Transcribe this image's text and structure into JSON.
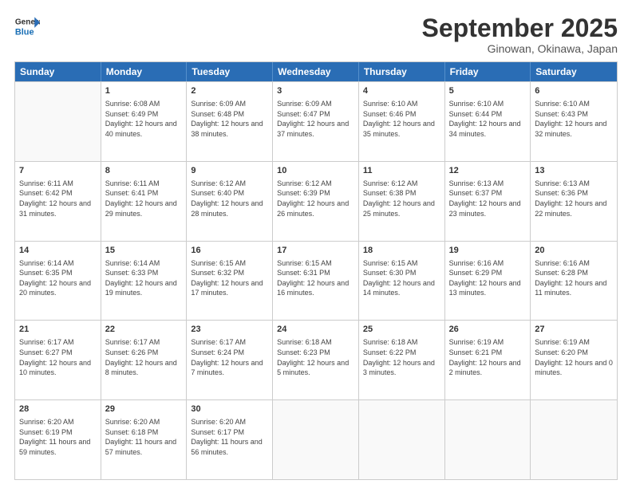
{
  "logo": {
    "line1": "General",
    "line2": "Blue"
  },
  "title": "September 2025",
  "location": "Ginowan, Okinawa, Japan",
  "weekdays": [
    "Sunday",
    "Monday",
    "Tuesday",
    "Wednesday",
    "Thursday",
    "Friday",
    "Saturday"
  ],
  "rows": [
    [
      {
        "day": "",
        "sunrise": "",
        "sunset": "",
        "daylight": ""
      },
      {
        "day": "1",
        "sunrise": "Sunrise: 6:08 AM",
        "sunset": "Sunset: 6:49 PM",
        "daylight": "Daylight: 12 hours and 40 minutes."
      },
      {
        "day": "2",
        "sunrise": "Sunrise: 6:09 AM",
        "sunset": "Sunset: 6:48 PM",
        "daylight": "Daylight: 12 hours and 38 minutes."
      },
      {
        "day": "3",
        "sunrise": "Sunrise: 6:09 AM",
        "sunset": "Sunset: 6:47 PM",
        "daylight": "Daylight: 12 hours and 37 minutes."
      },
      {
        "day": "4",
        "sunrise": "Sunrise: 6:10 AM",
        "sunset": "Sunset: 6:46 PM",
        "daylight": "Daylight: 12 hours and 35 minutes."
      },
      {
        "day": "5",
        "sunrise": "Sunrise: 6:10 AM",
        "sunset": "Sunset: 6:44 PM",
        "daylight": "Daylight: 12 hours and 34 minutes."
      },
      {
        "day": "6",
        "sunrise": "Sunrise: 6:10 AM",
        "sunset": "Sunset: 6:43 PM",
        "daylight": "Daylight: 12 hours and 32 minutes."
      }
    ],
    [
      {
        "day": "7",
        "sunrise": "Sunrise: 6:11 AM",
        "sunset": "Sunset: 6:42 PM",
        "daylight": "Daylight: 12 hours and 31 minutes."
      },
      {
        "day": "8",
        "sunrise": "Sunrise: 6:11 AM",
        "sunset": "Sunset: 6:41 PM",
        "daylight": "Daylight: 12 hours and 29 minutes."
      },
      {
        "day": "9",
        "sunrise": "Sunrise: 6:12 AM",
        "sunset": "Sunset: 6:40 PM",
        "daylight": "Daylight: 12 hours and 28 minutes."
      },
      {
        "day": "10",
        "sunrise": "Sunrise: 6:12 AM",
        "sunset": "Sunset: 6:39 PM",
        "daylight": "Daylight: 12 hours and 26 minutes."
      },
      {
        "day": "11",
        "sunrise": "Sunrise: 6:12 AM",
        "sunset": "Sunset: 6:38 PM",
        "daylight": "Daylight: 12 hours and 25 minutes."
      },
      {
        "day": "12",
        "sunrise": "Sunrise: 6:13 AM",
        "sunset": "Sunset: 6:37 PM",
        "daylight": "Daylight: 12 hours and 23 minutes."
      },
      {
        "day": "13",
        "sunrise": "Sunrise: 6:13 AM",
        "sunset": "Sunset: 6:36 PM",
        "daylight": "Daylight: 12 hours and 22 minutes."
      }
    ],
    [
      {
        "day": "14",
        "sunrise": "Sunrise: 6:14 AM",
        "sunset": "Sunset: 6:35 PM",
        "daylight": "Daylight: 12 hours and 20 minutes."
      },
      {
        "day": "15",
        "sunrise": "Sunrise: 6:14 AM",
        "sunset": "Sunset: 6:33 PM",
        "daylight": "Daylight: 12 hours and 19 minutes."
      },
      {
        "day": "16",
        "sunrise": "Sunrise: 6:15 AM",
        "sunset": "Sunset: 6:32 PM",
        "daylight": "Daylight: 12 hours and 17 minutes."
      },
      {
        "day": "17",
        "sunrise": "Sunrise: 6:15 AM",
        "sunset": "Sunset: 6:31 PM",
        "daylight": "Daylight: 12 hours and 16 minutes."
      },
      {
        "day": "18",
        "sunrise": "Sunrise: 6:15 AM",
        "sunset": "Sunset: 6:30 PM",
        "daylight": "Daylight: 12 hours and 14 minutes."
      },
      {
        "day": "19",
        "sunrise": "Sunrise: 6:16 AM",
        "sunset": "Sunset: 6:29 PM",
        "daylight": "Daylight: 12 hours and 13 minutes."
      },
      {
        "day": "20",
        "sunrise": "Sunrise: 6:16 AM",
        "sunset": "Sunset: 6:28 PM",
        "daylight": "Daylight: 12 hours and 11 minutes."
      }
    ],
    [
      {
        "day": "21",
        "sunrise": "Sunrise: 6:17 AM",
        "sunset": "Sunset: 6:27 PM",
        "daylight": "Daylight: 12 hours and 10 minutes."
      },
      {
        "day": "22",
        "sunrise": "Sunrise: 6:17 AM",
        "sunset": "Sunset: 6:26 PM",
        "daylight": "Daylight: 12 hours and 8 minutes."
      },
      {
        "day": "23",
        "sunrise": "Sunrise: 6:17 AM",
        "sunset": "Sunset: 6:24 PM",
        "daylight": "Daylight: 12 hours and 7 minutes."
      },
      {
        "day": "24",
        "sunrise": "Sunrise: 6:18 AM",
        "sunset": "Sunset: 6:23 PM",
        "daylight": "Daylight: 12 hours and 5 minutes."
      },
      {
        "day": "25",
        "sunrise": "Sunrise: 6:18 AM",
        "sunset": "Sunset: 6:22 PM",
        "daylight": "Daylight: 12 hours and 3 minutes."
      },
      {
        "day": "26",
        "sunrise": "Sunrise: 6:19 AM",
        "sunset": "Sunset: 6:21 PM",
        "daylight": "Daylight: 12 hours and 2 minutes."
      },
      {
        "day": "27",
        "sunrise": "Sunrise: 6:19 AM",
        "sunset": "Sunset: 6:20 PM",
        "daylight": "Daylight: 12 hours and 0 minutes."
      }
    ],
    [
      {
        "day": "28",
        "sunrise": "Sunrise: 6:20 AM",
        "sunset": "Sunset: 6:19 PM",
        "daylight": "Daylight: 11 hours and 59 minutes."
      },
      {
        "day": "29",
        "sunrise": "Sunrise: 6:20 AM",
        "sunset": "Sunset: 6:18 PM",
        "daylight": "Daylight: 11 hours and 57 minutes."
      },
      {
        "day": "30",
        "sunrise": "Sunrise: 6:20 AM",
        "sunset": "Sunset: 6:17 PM",
        "daylight": "Daylight: 11 hours and 56 minutes."
      },
      {
        "day": "",
        "sunrise": "",
        "sunset": "",
        "daylight": ""
      },
      {
        "day": "",
        "sunrise": "",
        "sunset": "",
        "daylight": ""
      },
      {
        "day": "",
        "sunrise": "",
        "sunset": "",
        "daylight": ""
      },
      {
        "day": "",
        "sunrise": "",
        "sunset": "",
        "daylight": ""
      }
    ]
  ]
}
